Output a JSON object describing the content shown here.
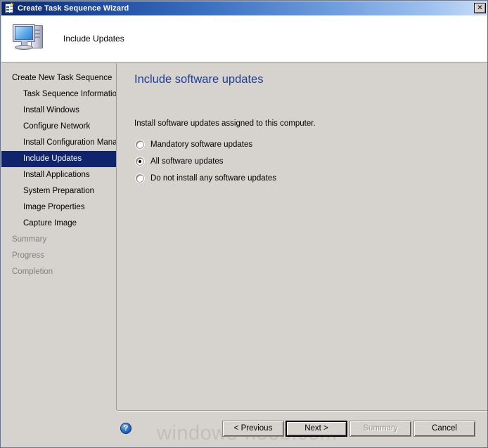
{
  "window": {
    "title": "Create Task Sequence Wizard",
    "title_icon": "task-sequence-clipboard-icon",
    "close_label": "✕",
    "titlebar_gradient_start": "#0a246a",
    "titlebar_gradient_end": "#c8ddf6",
    "face_color": "#d6d3ce"
  },
  "header": {
    "title": "Include Updates",
    "icon": "computer-monitor-icon"
  },
  "sidebar": {
    "items": [
      {
        "label": "Create New Task Sequence",
        "level": 0,
        "state": "normal"
      },
      {
        "label": "Task Sequence Information",
        "level": 1,
        "state": "normal"
      },
      {
        "label": "Install Windows",
        "level": 1,
        "state": "normal"
      },
      {
        "label": "Configure Network",
        "level": 1,
        "state": "normal"
      },
      {
        "label": "Install Configuration Manag",
        "level": 1,
        "state": "normal"
      },
      {
        "label": "Include Updates",
        "level": 1,
        "state": "selected"
      },
      {
        "label": "Install Applications",
        "level": 1,
        "state": "normal"
      },
      {
        "label": "System Preparation",
        "level": 1,
        "state": "normal"
      },
      {
        "label": "Image Properties",
        "level": 1,
        "state": "normal"
      },
      {
        "label": "Capture Image",
        "level": 1,
        "state": "normal"
      },
      {
        "label": "Summary",
        "level": 0,
        "state": "disabled"
      },
      {
        "label": "Progress",
        "level": 0,
        "state": "disabled"
      },
      {
        "label": "Completion",
        "level": 0,
        "state": "disabled"
      }
    ],
    "selected_color": "#10246e",
    "scrollbar": {
      "left_arrow": "◀",
      "right_arrow": "▶"
    }
  },
  "content": {
    "heading": "Include software updates",
    "heading_color": "#1d3f94",
    "description": "Install software updates assigned to this computer.",
    "radio_group_name": "software-updates",
    "options": [
      {
        "label": "Mandatory software updates",
        "selected": false
      },
      {
        "label": "All software updates",
        "selected": true
      },
      {
        "label": "Do not install any software updates",
        "selected": false
      }
    ]
  },
  "footer": {
    "help_glyph": "?",
    "watermark": "windows-noob.com",
    "buttons": [
      {
        "id": "previous",
        "label": "< Previous",
        "state": "normal"
      },
      {
        "id": "next",
        "label": "Next >",
        "state": "focused"
      },
      {
        "id": "summary",
        "label": "Summary",
        "state": "disabled"
      },
      {
        "id": "cancel",
        "label": "Cancel",
        "state": "normal"
      }
    ]
  }
}
